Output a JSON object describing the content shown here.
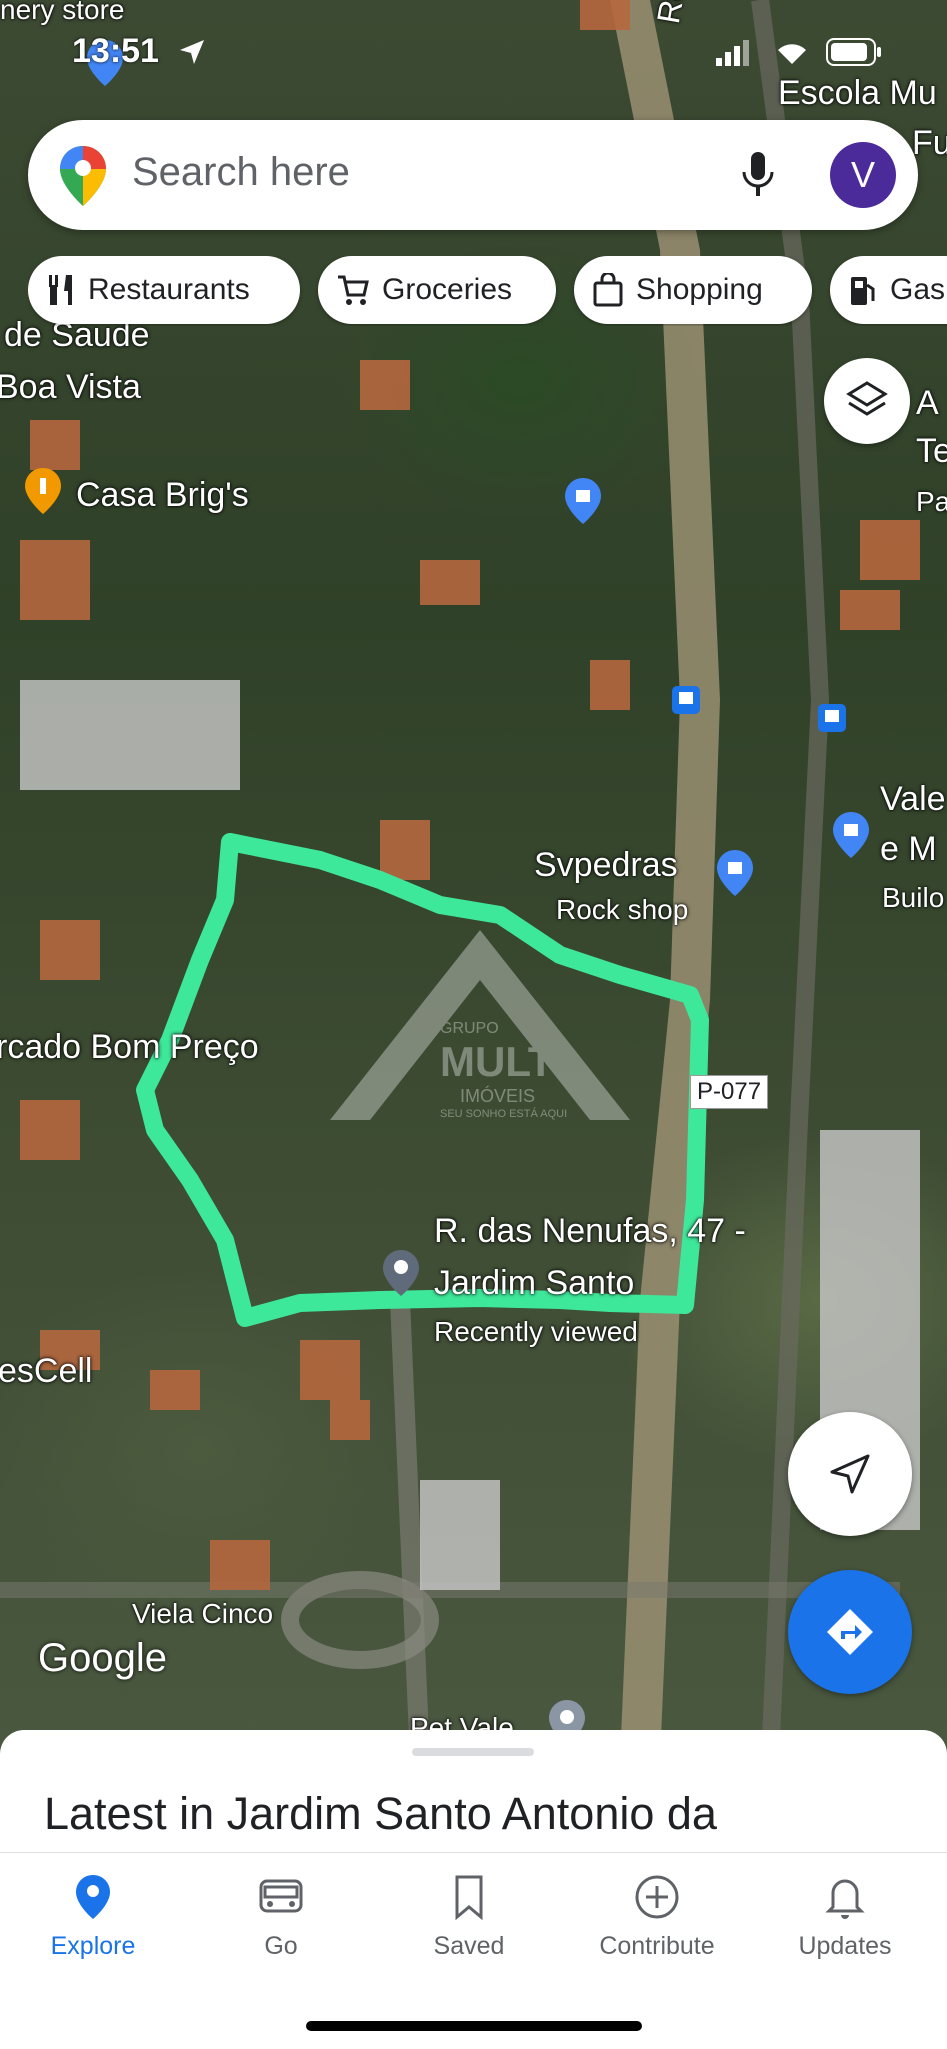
{
  "status_bar": {
    "time": "13:51"
  },
  "search": {
    "placeholder": "Search here",
    "avatar_letter": "V"
  },
  "chips": [
    {
      "label": "Restaurants",
      "icon": "fork-knife-icon"
    },
    {
      "label": "Groceries",
      "icon": "cart-icon"
    },
    {
      "label": "Shopping",
      "icon": "bag-icon"
    },
    {
      "label": "Gas",
      "icon": "gas-pump-icon"
    }
  ],
  "map_labels": {
    "top_store": "nery store",
    "rod": "Rod.",
    "escola": "Escola Mu",
    "escola2": "Fu",
    "saude": "de Saude",
    "boa_vista": "Boa Vista",
    "casa_brigs": "Casa Brig's",
    "right_a": "A",
    "right_te": "Te",
    "right_pa": "Pa",
    "svpedras": "Svpedras",
    "rock_shop": "Rock shop",
    "vale": "Vale",
    "e_m": "e M",
    "build": "Builo",
    "mercado": "rcado Bom Preço",
    "sp077": "P-077",
    "place_name_1": "R. das Nenufas, 47 -",
    "place_name_2": "Jardim Santo",
    "recently_viewed": "Recently viewed",
    "escell": "esCell",
    "viela": "Viela Cinco",
    "pet": "Pet Vale"
  },
  "watermark": {
    "brand_top": "GRUPO",
    "brand_main": "MULT",
    "brand_sub": "IMÓVEIS",
    "tagline": "SEU SONHO ESTÁ AQUI"
  },
  "google_logo": "Google",
  "sheet": {
    "title": "Latest in Jardim Santo Antonio da"
  },
  "nav": [
    {
      "label": "Explore",
      "icon": "explore-pin-icon",
      "active": true
    },
    {
      "label": "Go",
      "icon": "car-icon",
      "active": false
    },
    {
      "label": "Saved",
      "icon": "bookmark-icon",
      "active": false
    },
    {
      "label": "Contribute",
      "icon": "plus-circle-icon",
      "active": false
    },
    {
      "label": "Updates",
      "icon": "bell-icon",
      "active": false
    }
  ],
  "colors": {
    "accent": "#1a73e8",
    "outline": "#3ee89a",
    "avatar": "#4b2a9a"
  }
}
